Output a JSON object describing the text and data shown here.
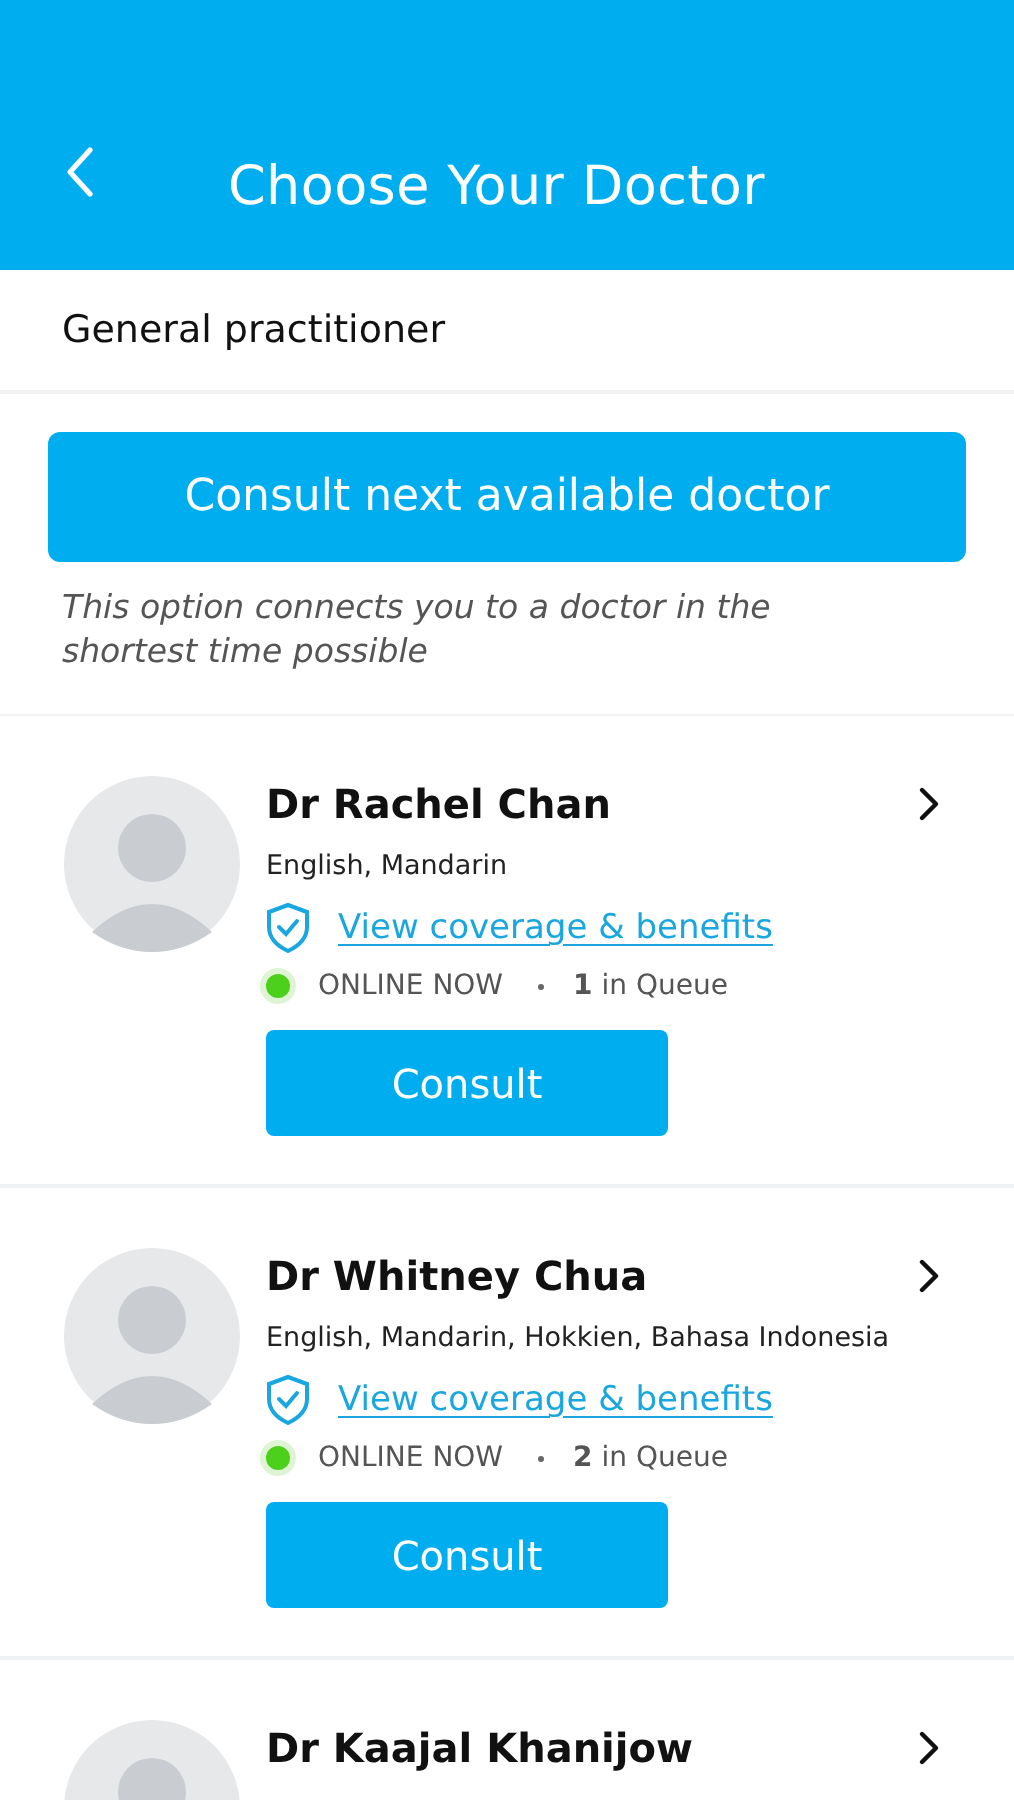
{
  "header": {
    "title": "Choose Your Doctor"
  },
  "category": "General practitioner",
  "next_available": {
    "label": "Consult next available doctor",
    "note": "This option connects you to a doctor in the shortest time possible"
  },
  "doctors": [
    {
      "name": "Dr Rachel Chan",
      "languages": "English, Mandarin",
      "coverage_link": "View coverage & benefits",
      "online": true,
      "status": "ONLINE NOW",
      "queue": "**1** in Queue",
      "button": "Consult"
    },
    {
      "name": "Dr Whitney Chua",
      "languages": "English, Mandarin, Hokkien, Bahasa Indonesia",
      "coverage_link": "View coverage & benefits",
      "online": true,
      "status": "ONLINE NOW",
      "queue": "**2** in Queue",
      "button": "Consult"
    },
    {
      "name": "Dr Kaajal Khanijow"
    }
  ]
}
